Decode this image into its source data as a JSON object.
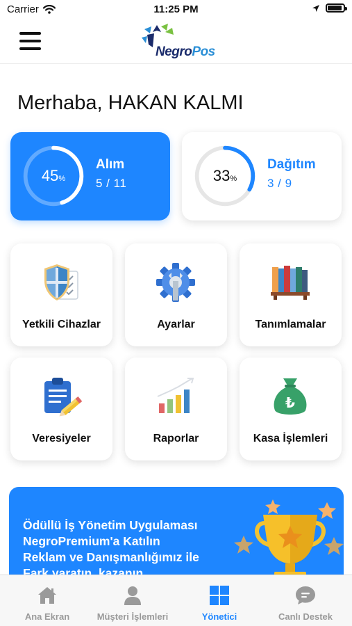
{
  "status_bar": {
    "carrier": "Carrier",
    "time": "11:25 PM"
  },
  "header": {
    "logo": {
      "brand_part1": "Negro",
      "brand_part2": "Pos"
    }
  },
  "greeting": "Merhaba, HAKAN KALMI",
  "stats": [
    {
      "label": "Alım",
      "progress_percent": 45,
      "percent_text": "45",
      "percent_unit": "%",
      "count_text": "5 / 11"
    },
    {
      "label": "Dağıtım",
      "progress_percent": 33,
      "percent_text": "33",
      "percent_unit": "%",
      "count_text": "3 / 9"
    }
  ],
  "menu": [
    {
      "label": "Yetkili Cihazlar",
      "icon": "shield-checklist-icon"
    },
    {
      "label": "Ayarlar",
      "icon": "gear-wrench-icon"
    },
    {
      "label": "Tanımlamalar",
      "icon": "bookshelf-icon"
    },
    {
      "label": "Veresiyeler",
      "icon": "clipboard-pencil-icon"
    },
    {
      "label": "Raporlar",
      "icon": "bar-chart-icon"
    },
    {
      "label": "Kasa İşlemleri",
      "icon": "money-bag-icon"
    }
  ],
  "promo": {
    "lines": [
      "Ödüllü İş Yönetim Uygulaması",
      "NegroPremium'a Katılın",
      "Reklam ve Danışmanlığımız ile",
      "Fark yaratın, kazanın"
    ]
  },
  "tabs": [
    {
      "label": "Ana Ekran",
      "icon": "home-icon",
      "active": false
    },
    {
      "label": "Müşteri İşlemleri",
      "icon": "person-icon",
      "active": false
    },
    {
      "label": "Yönetici",
      "icon": "grid-icon",
      "active": true
    },
    {
      "label": "Canlı Destek",
      "icon": "chat-bubble-icon",
      "active": false
    }
  ],
  "colors": {
    "primary": "#1e86ff",
    "tab_inactive": "#9a9a9a",
    "logo_navy": "#1a2b6b",
    "logo_blue": "#2b8fd6"
  }
}
